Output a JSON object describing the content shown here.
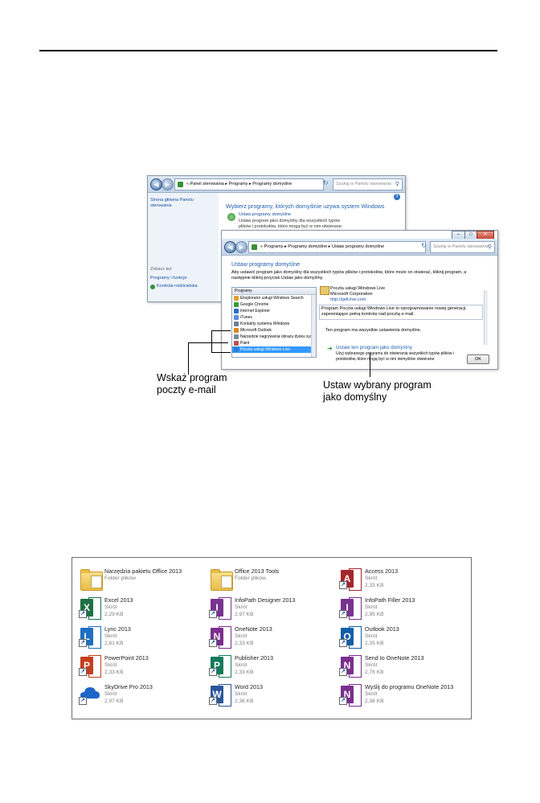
{
  "figure1": {
    "back_window": {
      "breadcrumb": "« Panel sterowania ▸ Programy ▸ Programy domyślne",
      "search_placeholder": "Szukaj w Panelu sterowania",
      "side_home": "Strona główna Panelu sterowania",
      "side_see_also": "Zobacz też",
      "side_programs": "Programy i funkcje",
      "side_uac": "Kontrola rodzicielska",
      "title": "Wybierz programy, których domyślnie używa system Windows",
      "link": "Ustaw programy domyślne",
      "desc": "Ustaw program jako domyślny dla wszystkich typów plików i protokołów, które mogą być w nim otwierane."
    },
    "front_window": {
      "breadcrumb": "« Programy ▸ Programy domyślne ▸ Ustaw programy domyślne",
      "search_placeholder": "Szukaj w Panelu sterowania",
      "title": "Ustaw programy domyślne",
      "intro": "Aby ustawić program jako domyślny dla wszystkich typów plików i protokołów, które może on otwierać, kliknij program, a następnie kliknij przycisk Ustaw jako domyślny.",
      "list_header": "Programy",
      "programs": [
        {
          "name": "Eksplorator usługi Windows Search",
          "color": "#e0a030"
        },
        {
          "name": "Google Chrome",
          "color": "#3a9a3a"
        },
        {
          "name": "Internet Explorer",
          "color": "#2a6fc9"
        },
        {
          "name": "iTunes",
          "color": "#5a8fd8"
        },
        {
          "name": "Kontakty systemu Windows",
          "color": "#6a7f9a"
        },
        {
          "name": "Microsoft Outlook",
          "color": "#d98a1a"
        },
        {
          "name": "Narzędzie nagrywania obrazu dysku syst",
          "color": "#7a8a9a"
        },
        {
          "name": "Paint",
          "color": "#c0504d"
        },
        {
          "name": "Poczta usługi Windows Live",
          "color": "#2f7fd6"
        }
      ],
      "selected_index": 8,
      "app_name": "Poczta usługi Windows Live",
      "app_vendor": "Microsoft Corporation",
      "app_url": "http://gefi.live.com",
      "app_desc": "Program Poczta usługi Windows Live to oprogramowanie nowej generacji, zapewniające pełną kontrolę nad pocztą e-mail.",
      "status": "Ten program ma wszystkie ustawienia domyślne.",
      "action_title": "Ustaw ten program jako domyślny",
      "action_desc": "Użyj wybranego programu do otwierania wszystkich typów plików i protokołów, które mogą być w nim domyślnie otwierane.",
      "ok_label": "OK"
    },
    "callout_left": [
      "Wskaż program",
      "poczty e-mail"
    ],
    "callout_right": [
      "Ustaw wybrany program",
      "jako domyślny"
    ]
  },
  "figure2": {
    "items": [
      {
        "name": "Narzędzia pakietu Office 2013",
        "type": "Folder plików",
        "size": "",
        "icon": "folder-icon",
        "color": "#e8bd48",
        "letter": ""
      },
      {
        "name": "Office 2013 Tools",
        "type": "Folder plików",
        "size": "",
        "icon": "folder-icon",
        "color": "#e8bd48",
        "letter": ""
      },
      {
        "name": "Access 2013",
        "type": "Skrót",
        "size": "2,33 KB",
        "icon": "access-icon",
        "color": "#a4262c",
        "letter": "A"
      },
      {
        "name": "Excel 2013",
        "type": "Skrót",
        "size": "2,29 KB",
        "icon": "excel-icon",
        "color": "#1e7145",
        "letter": "X"
      },
      {
        "name": "InfoPath Designer 2013",
        "type": "Skrót",
        "size": "2,97 KB",
        "icon": "infopath-designer-icon",
        "color": "#77338f",
        "letter": "I"
      },
      {
        "name": "InfoPath Filler 2013",
        "type": "Skrót",
        "size": "2,95 KB",
        "icon": "infopath-filler-icon",
        "color": "#77338f",
        "letter": "I"
      },
      {
        "name": "Lync 2013",
        "type": "Skrót",
        "size": "2,81 KB",
        "icon": "lync-icon",
        "color": "#1e6fc2",
        "letter": "L"
      },
      {
        "name": "OneNote 2013",
        "type": "Skrót",
        "size": "2,33 KB",
        "icon": "onenote-icon",
        "color": "#7b2e8e",
        "letter": "N"
      },
      {
        "name": "Outlook 2013",
        "type": "Skrót",
        "size": "2,35 KB",
        "icon": "outlook-icon",
        "color": "#0f5ea8",
        "letter": "O"
      },
      {
        "name": "PowerPoint 2013",
        "type": "Skrót",
        "size": "2,33 KB",
        "icon": "powerpoint-icon",
        "color": "#c43e1c",
        "letter": "P"
      },
      {
        "name": "Publisher 2013",
        "type": "Skrót",
        "size": "2,33 KB",
        "icon": "publisher-icon",
        "color": "#137b5a",
        "letter": "P"
      },
      {
        "name": "Send to OneNote 2013",
        "type": "Skrót",
        "size": "2,76 KB",
        "icon": "send-to-onenote-icon",
        "color": "#7b2e8e",
        "letter": "N"
      },
      {
        "name": "SkyDrive Pro 2013",
        "type": "Skrót",
        "size": "2,97 KB",
        "icon": "skydrive-icon",
        "color": "#1d65c8",
        "letter": ""
      },
      {
        "name": "Word 2013",
        "type": "Skrót",
        "size": "2,36 KB",
        "icon": "word-icon",
        "color": "#2a5699",
        "letter": "W"
      },
      {
        "name": "Wyślij do programu OneNote 2013",
        "type": "Skrót",
        "size": "2,36 KB",
        "icon": "send-to-onenote-icon",
        "color": "#7b2e8e",
        "letter": "N"
      }
    ]
  }
}
